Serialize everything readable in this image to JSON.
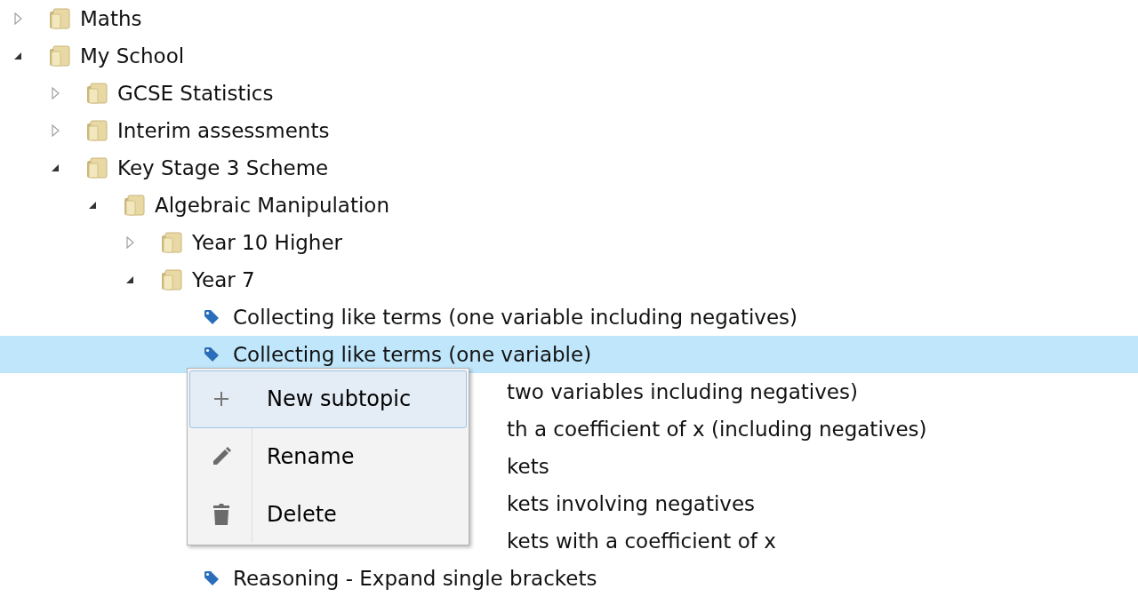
{
  "tree": [
    {
      "kind": "folder",
      "label": "Maths",
      "expanded": false,
      "selected": false
    },
    {
      "kind": "folder",
      "label": "My School",
      "expanded": true,
      "selected": false,
      "children": [
        {
          "kind": "folder",
          "label": "GCSE Statistics",
          "expanded": false,
          "selected": false
        },
        {
          "kind": "folder",
          "label": "Interim assessments",
          "expanded": false,
          "selected": false
        },
        {
          "kind": "folder",
          "label": "Key Stage 3 Scheme",
          "expanded": true,
          "selected": false,
          "children": [
            {
              "kind": "folder",
              "label": "Algebraic Manipulation",
              "expanded": true,
              "selected": false,
              "children": [
                {
                  "kind": "folder",
                  "label": "Year 10 Higher",
                  "expanded": false,
                  "selected": false
                },
                {
                  "kind": "folder",
                  "label": "Year 7",
                  "expanded": true,
                  "selected": false,
                  "children": [
                    {
                      "kind": "topic",
                      "label": "Collecting like terms (one variable including negatives)",
                      "selected": false
                    },
                    {
                      "kind": "topic",
                      "label": "Collecting like terms (one variable)",
                      "selected": true
                    },
                    {
                      "kind": "covered",
                      "label": "two variables including negatives)",
                      "selected": false
                    },
                    {
                      "kind": "covered",
                      "label": "th a coefficient of x (including negatives)",
                      "selected": false
                    },
                    {
                      "kind": "covered",
                      "label": "kets",
                      "selected": false
                    },
                    {
                      "kind": "covered",
                      "label": "kets involving negatives",
                      "selected": false
                    },
                    {
                      "kind": "covered",
                      "label": "kets with a coefficient of x",
                      "selected": false
                    },
                    {
                      "kind": "topic",
                      "label": "Reasoning - Expand single brackets",
                      "selected": false
                    }
                  ]
                }
              ]
            }
          ]
        }
      ]
    }
  ],
  "context_menu": {
    "items": [
      {
        "kind": "add",
        "label": "New subtopic",
        "selected": true
      },
      {
        "kind": "rename",
        "label": "Rename",
        "selected": false
      },
      {
        "kind": "delete",
        "label": "Delete",
        "selected": false
      }
    ]
  }
}
